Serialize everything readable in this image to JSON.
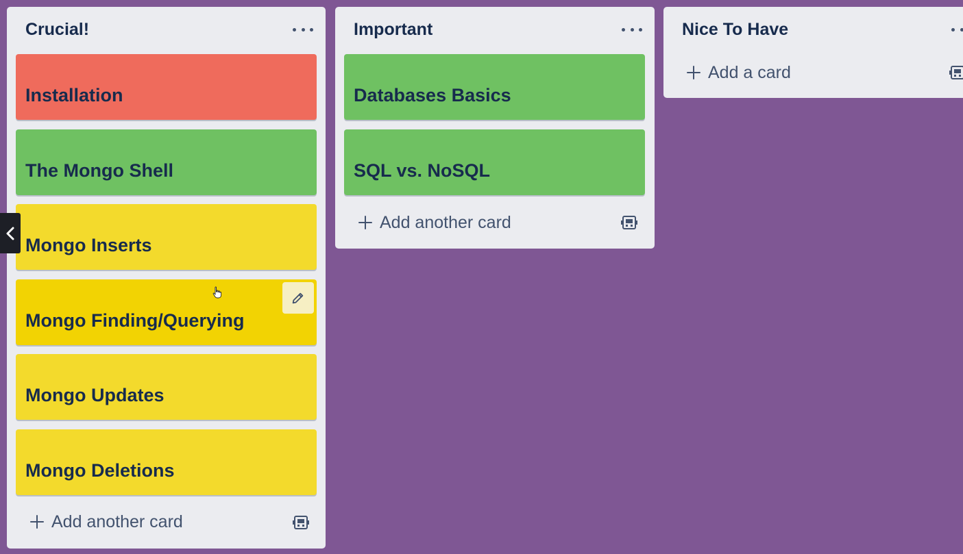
{
  "lists": [
    {
      "title": "Crucial!",
      "cards": [
        {
          "title": "Installation",
          "color": "#ef6b5c"
        },
        {
          "title": "The Mongo Shell",
          "color": "#6fc162"
        },
        {
          "title": "Mongo Inserts",
          "color": "#f3da2c"
        },
        {
          "title": "Mongo Finding/Querying",
          "color": "#f2d303"
        },
        {
          "title": "Mongo Updates",
          "color": "#f3da2c"
        },
        {
          "title": "Mongo Deletions",
          "color": "#f3da2c"
        }
      ],
      "add_label": "Add another card"
    },
    {
      "title": "Important",
      "cards": [
        {
          "title": "Databases Basics",
          "color": "#6fc162"
        },
        {
          "title": "SQL vs. NoSQL",
          "color": "#6fc162"
        }
      ],
      "add_label": "Add another card"
    },
    {
      "title": "Nice To Have",
      "cards": [],
      "add_label": "Add a card"
    }
  ],
  "icons": {
    "menu": "more-horizontal-icon",
    "add": "plus-icon",
    "template": "card-template-icon",
    "edit": "pencil-icon",
    "collapse": "chevron-left-icon",
    "cursor": "hand-cursor-icon"
  },
  "colors": {
    "board_background": "#7f5794",
    "list_background": "#ebecf0",
    "text": "#172b4d"
  }
}
